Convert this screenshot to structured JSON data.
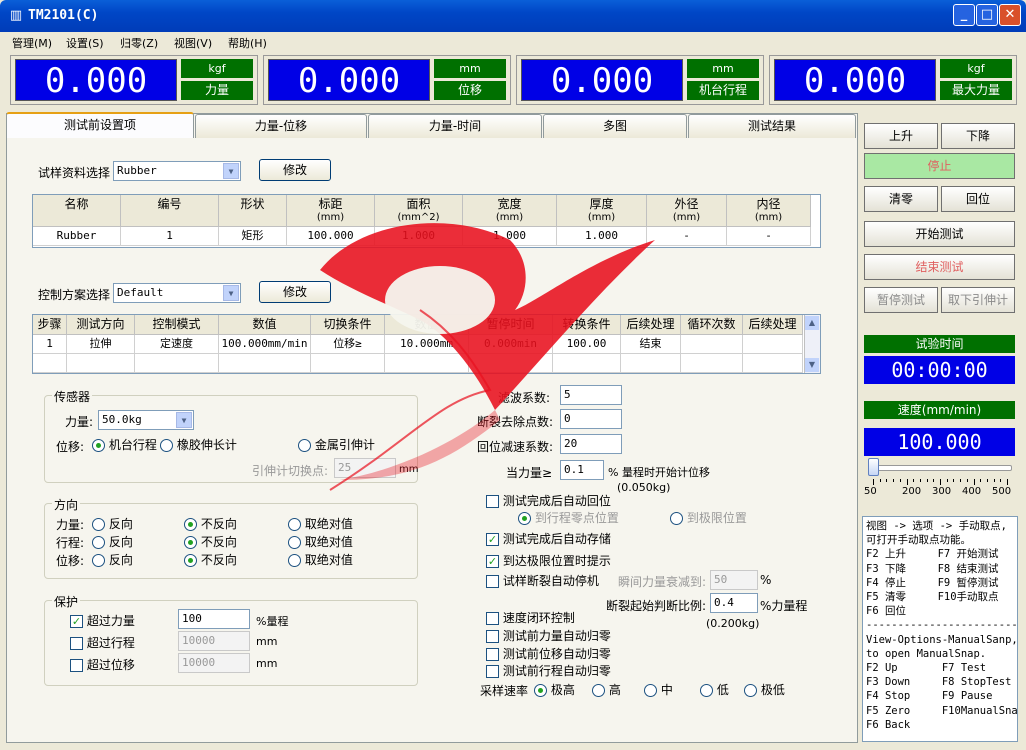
{
  "window": {
    "title": "TM2101(C)",
    "icon": "app-icon",
    "min": "_",
    "max": "□",
    "close": "✕"
  },
  "menu": [
    "管理(M)",
    "设置(S)",
    "归零(Z)",
    "视图(V)",
    "帮助(H)"
  ],
  "displays": [
    {
      "value": "0.000",
      "unit": "kgf",
      "name": "力量"
    },
    {
      "value": "0.000",
      "unit": "mm",
      "name": "位移"
    },
    {
      "value": "0.000",
      "unit": "mm",
      "name": "机台行程"
    },
    {
      "value": "0.000",
      "unit": "kgf",
      "name": "最大力量"
    }
  ],
  "tabs": [
    "测试前设置项",
    "力量-位移",
    "力量-时间",
    "多图",
    "测试结果"
  ],
  "sample": {
    "label": "试样资料选择",
    "value": "Rubber",
    "modify": "修改",
    "headers": [
      [
        "名称",
        ""
      ],
      [
        "编号",
        ""
      ],
      [
        "形状",
        ""
      ],
      [
        "标距",
        "(mm)"
      ],
      [
        "面积",
        "(mm^2)"
      ],
      [
        "宽度",
        "(mm)"
      ],
      [
        "厚度",
        "(mm)"
      ],
      [
        "外径",
        "(mm)"
      ],
      [
        "内径",
        "(mm)"
      ]
    ],
    "row": [
      "Rubber",
      "1",
      "矩形",
      "100.000",
      "1.000",
      "1.000",
      "1.000",
      "-",
      "-"
    ]
  },
  "control": {
    "label": "控制方案选择",
    "value": "Default",
    "modify": "修改",
    "headers": [
      "步骤",
      "测试方向",
      "控制模式",
      "数值",
      "切换条件",
      "数值",
      "暂停时间",
      "转换条件(%)",
      "后续处理",
      "循环次数",
      "后续处理"
    ],
    "row": [
      "1",
      "拉伸",
      "定速度",
      "100.000mm/min",
      "位移≥",
      "10.000mm",
      "0.000min",
      "100.00",
      "结束",
      "",
      ""
    ],
    "scroll_up": "▲",
    "scroll_down": "▼"
  },
  "sensor": {
    "title": "传感器",
    "force_label": "力量:",
    "force_value": "50.0kg",
    "disp_label": "位移:",
    "opt1": "机台行程",
    "opt2": "橡胶伸长计",
    "opt3": "金属引伸计",
    "switch_label": "引伸计切换点:",
    "switch_value": "25",
    "switch_unit": "mm"
  },
  "direction": {
    "title": "方向",
    "rows": [
      {
        "label": "力量:",
        "a": "反向",
        "b": "不反向",
        "c": "取绝对值"
      },
      {
        "label": "行程:",
        "a": "反向",
        "b": "不反向",
        "c": "取绝对值"
      },
      {
        "label": "位移:",
        "a": "反向",
        "b": "不反向",
        "c": "取绝对值"
      }
    ]
  },
  "protect": {
    "title": "保护",
    "rows": [
      {
        "label": "超过力量",
        "value": "100",
        "unit": "%量程",
        "checked": true
      },
      {
        "label": "超过行程",
        "value": "10000",
        "unit": "mm",
        "checked": false
      },
      {
        "label": "超过位移",
        "value": "10000",
        "unit": "mm",
        "checked": false
      }
    ]
  },
  "options": {
    "filter_label": "滤波系数:",
    "filter_value": "5",
    "break_label": "断裂去除点数:",
    "break_value": "0",
    "return_label": "回位减速系数:",
    "return_value": "20",
    "force_when_label": "当力量≥",
    "force_when_value": "0.1",
    "force_when_suffix": "% 量程时开始计位移",
    "force_when_note": "(0.050kg)",
    "auto_return": "测试完成后自动回位",
    "to_zero": "到行程零点位置",
    "to_limit": "到极限位置",
    "auto_save": "测试完成后自动存储",
    "limit_prompt": "到达极限位置时提示",
    "break_stop": "试样断裂自动停机",
    "decay_label": "瞬间力量衰减到:",
    "decay_value": "50",
    "decay_unit": "%",
    "break_ratio_label": "断裂起始判断比例:",
    "break_ratio_value": "0.4",
    "break_ratio_unit": "%力量程",
    "break_ratio_note": "(0.200kg)",
    "speed_loop": "速度闭环控制",
    "zero_force": "测试前力量自动归零",
    "zero_disp": "测试前位移自动归零",
    "zero_travel": "测试前行程自动归零",
    "rate_label": "采样速率",
    "rates": [
      "极高",
      "高",
      "中",
      "低",
      "极低"
    ]
  },
  "side": {
    "up": "上升",
    "down": "下降",
    "stop": "停止",
    "clear": "清零",
    "back": "回位",
    "start": "开始测试",
    "end": "结束测试",
    "pause": "暂停测试",
    "take": "取下引伸计",
    "time_label": "试验时间",
    "time_value": "00:00:00",
    "speed_label": "速度(mm/min)",
    "speed_value": "100.000",
    "slider_ticks": [
      "50",
      "200",
      "300",
      "400",
      "500"
    ],
    "slider_level": 0.0
  },
  "help": "视图 -> 选项 -> 手动取点,\n可打开手动取点功能。\nF2 上升     F7 开始测试\nF3 下降     F8 结束测试\nF4 停止     F9 暂停测试\nF5 清零     F10手动取点\nF6 回位\n------------------------\nView-Options-ManualSanp,\nto open ManualSnap.\nF2 Up       F7 Test\nF3 Down     F8 StopTest\nF4 Stop     F9 Pause\nF5 Zero     F10ManualSnap\nF6 Back"
}
